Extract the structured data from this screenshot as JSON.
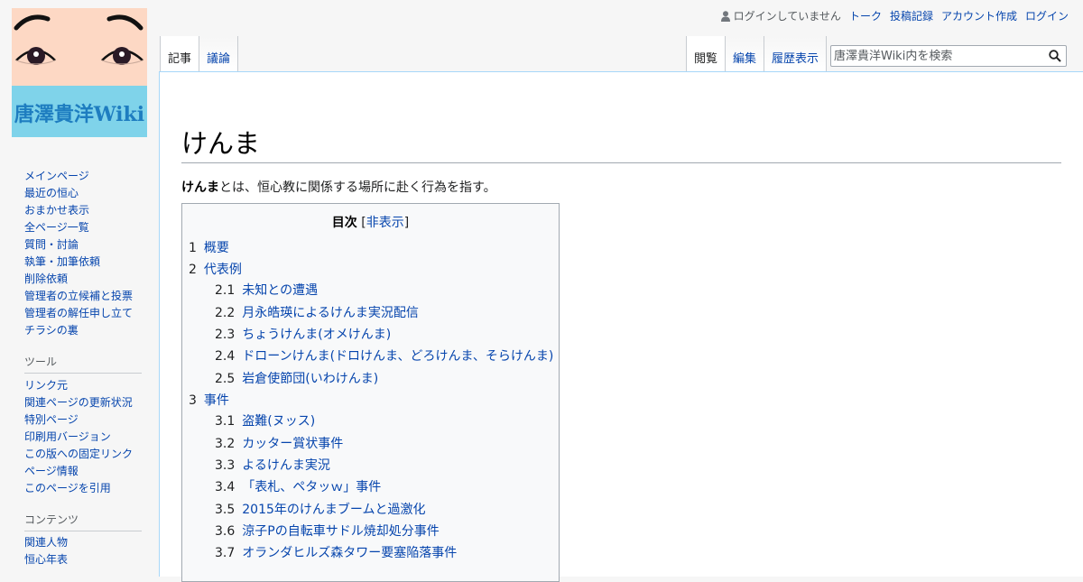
{
  "logo": {
    "text": "唐澤貴洋Wiki"
  },
  "personal": {
    "anon_text": "ログインしていません",
    "links": [
      "トーク",
      "投稿記録",
      "アカウント作成",
      "ログイン"
    ]
  },
  "tabs": {
    "left": [
      "記事",
      "議論"
    ],
    "right": [
      "閲覧",
      "編集",
      "履歴表示"
    ],
    "selected": [
      "記事",
      "閲覧"
    ]
  },
  "search": {
    "placeholder": "唐澤貴洋Wiki内を検索"
  },
  "page": {
    "title": "けんま",
    "intro_bold": "けんま",
    "intro_rest": "とは、恒心教に関係する場所に赴く行為を指す。"
  },
  "toc": {
    "title": "目次",
    "bracket_open": "[",
    "hide_label": "非表示",
    "bracket_close": "]",
    "items": [
      {
        "num": "1",
        "text": "概要"
      },
      {
        "num": "2",
        "text": "代表例"
      },
      {
        "num": "2.1",
        "text": "未知との遭遇"
      },
      {
        "num": "2.2",
        "text": "月永皓瑛によるけんま実況配信"
      },
      {
        "num": "2.3",
        "text": "ちょうけんま(オメけんま)"
      },
      {
        "num": "2.4",
        "text": "ドローンけんま(ドロけんま、どろけんま、そらけんま)"
      },
      {
        "num": "2.5",
        "text": "岩倉使節団(いわけんま)"
      },
      {
        "num": "3",
        "text": "事件"
      },
      {
        "num": "3.1",
        "text": "盗難(ヌッス)"
      },
      {
        "num": "3.2",
        "text": "カッター賞状事件"
      },
      {
        "num": "3.3",
        "text": "よるけんま実況"
      },
      {
        "num": "3.4",
        "text": "「表札、ペタッｗ」事件"
      },
      {
        "num": "3.5",
        "text": "2015年のけんまブームと過激化"
      },
      {
        "num": "3.6",
        "text": "涼子Pの自転車サドル焼却処分事件"
      },
      {
        "num": "3.7",
        "text": "オランダヒルズ森タワー要塞陥落事件"
      }
    ]
  },
  "sidebar": {
    "navigation": [
      "メインページ",
      "最近の恒心",
      "おまかせ表示",
      "全ページ一覧",
      "質問・討論",
      "執筆・加筆依頼",
      "削除依頼",
      "管理者の立候補と投票",
      "管理者の解任申し立て",
      "チラシの裏"
    ],
    "tools_heading": "ツール",
    "tools": [
      "リンク元",
      "関連ページの更新状況",
      "特別ページ",
      "印刷用バージョン",
      "この版への固定リンク",
      "ページ情報",
      "このページを引用"
    ],
    "contents_heading": "コンテンツ",
    "contents": [
      "関連人物",
      "恒心年表"
    ]
  }
}
